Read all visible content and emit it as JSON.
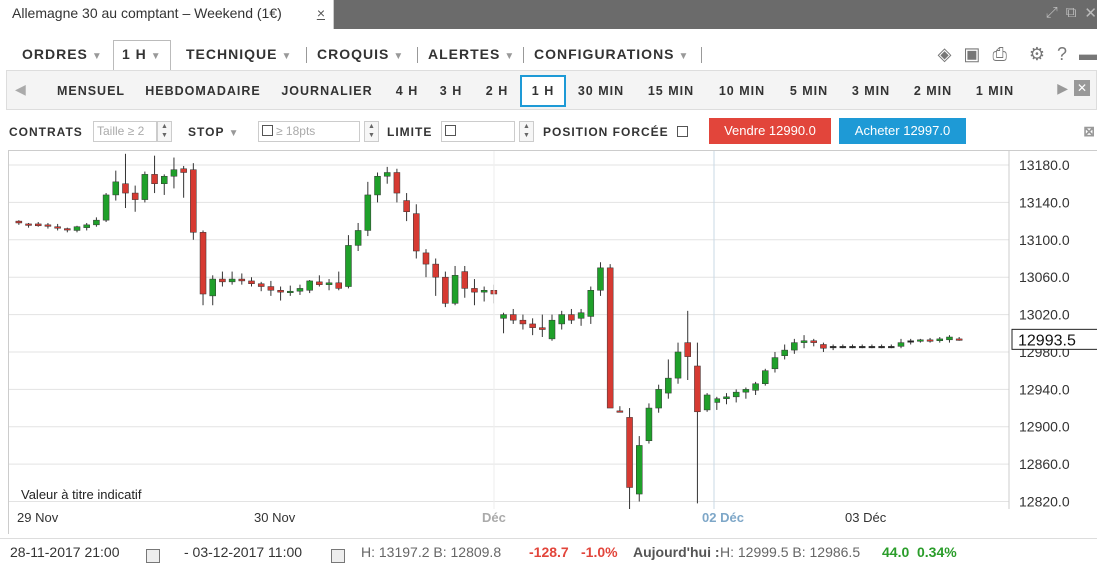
{
  "window": {
    "tab_title": "Allemagne 30 au comptant – Weekend (1€)",
    "tab_close": "×"
  },
  "menu": {
    "items": [
      {
        "label": "ORDRES"
      },
      {
        "label": "1 H"
      },
      {
        "label": "TECHNIQUE"
      },
      {
        "label": "CROQUIS"
      },
      {
        "label": "ALERTES"
      },
      {
        "label": "CONFIGURATIONS"
      }
    ]
  },
  "timeframes": {
    "items": [
      "MENSUEL",
      "HEBDOMADAIRE",
      "JOURNALIER",
      "4 H",
      "3 H",
      "2 H",
      "1 H",
      "30 MIN",
      "15 MIN",
      "10 MIN",
      "5 MIN",
      "3 MIN",
      "2 MIN",
      "1 MIN"
    ],
    "selected": "1 H"
  },
  "order": {
    "contrats_label": "CONTRATS",
    "taille_placeholder": "Taille ≥ 2",
    "stop_label": "STOP",
    "stop_placeholder": "≥ 18pts",
    "limite_label": "LIMITE",
    "position_label": "POSITION FORCÉE",
    "sell_label": "Vendre 12990.0",
    "buy_label": "Acheter 12997.0"
  },
  "chart_data": {
    "type": "candlestick",
    "y_ticks": [
      "13180.0",
      "13140.0",
      "13100.0",
      "13060.0",
      "13020.0",
      "12980.0",
      "12940.0",
      "12900.0",
      "12860.0",
      "12820.0"
    ],
    "ylim": [
      12812,
      13195
    ],
    "x_labels": [
      {
        "label": "29 Nov",
        "style": "normal"
      },
      {
        "label": "30 Nov",
        "style": "normal"
      },
      {
        "label": "Déc",
        "style": "muted"
      },
      {
        "label": "02 Déc",
        "style": "highlight"
      },
      {
        "label": "03 Déc",
        "style": "normal"
      }
    ],
    "current_price": "12993.5",
    "note": "Valeur à titre indicatif",
    "colors": {
      "up": "#1fa02a",
      "down": "#d63a32",
      "flat": "#222222",
      "highlight": "#1e9ad6"
    },
    "candles": [
      [
        13120,
        13121,
        13116,
        13118
      ],
      [
        13117,
        13118,
        13113,
        13116
      ],
      [
        13117,
        13119,
        13114,
        13115
      ],
      [
        13116,
        13118,
        13112,
        13115
      ],
      [
        13114,
        13117,
        13110,
        13113
      ],
      [
        13112,
        13113,
        13108,
        13111
      ],
      [
        13110,
        13115,
        13108,
        13114
      ],
      [
        13113,
        13118,
        13110,
        13116
      ],
      [
        13116,
        13124,
        13114,
        13121
      ],
      [
        13121,
        13150,
        13119,
        13148
      ],
      [
        13148,
        13174,
        13142,
        13162
      ],
      [
        13160,
        13192,
        13134,
        13150
      ],
      [
        13150,
        13158,
        13130,
        13143
      ],
      [
        13143,
        13173,
        13140,
        13170
      ],
      [
        13170,
        13190,
        13150,
        13160
      ],
      [
        13160,
        13170,
        13148,
        13168
      ],
      [
        13168,
        13188,
        13155,
        13175
      ],
      [
        13176,
        13179,
        13145,
        13172
      ],
      [
        13175,
        13182,
        13100,
        13108
      ],
      [
        13108,
        13110,
        13030,
        13042
      ],
      [
        13040,
        13062,
        13030,
        13058
      ],
      [
        13058,
        13066,
        13050,
        13055
      ],
      [
        13055,
        13066,
        13052,
        13058
      ],
      [
        13058,
        13064,
        13052,
        13056
      ],
      [
        13056,
        13060,
        13050,
        13053
      ],
      [
        13053,
        13055,
        13045,
        13050
      ],
      [
        13050,
        13056,
        13040,
        13046
      ],
      [
        13046,
        13050,
        13035,
        13044
      ],
      [
        13044,
        13051,
        13040,
        13045
      ],
      [
        13045,
        13052,
        13041,
        13048
      ],
      [
        13046,
        13057,
        13043,
        13056
      ],
      [
        13055,
        13062,
        13050,
        13052
      ],
      [
        13052,
        13058,
        13046,
        13054
      ],
      [
        13054,
        13066,
        13046,
        13048
      ],
      [
        13050,
        13105,
        13048,
        13094
      ],
      [
        13094,
        13118,
        13088,
        13110
      ],
      [
        13110,
        13162,
        13104,
        13148
      ],
      [
        13148,
        13172,
        13140,
        13168
      ],
      [
        13168,
        13178,
        13160,
        13172
      ],
      [
        13172,
        13176,
        13140,
        13150
      ],
      [
        13142,
        13150,
        13120,
        13130
      ],
      [
        13128,
        13138,
        13080,
        13088
      ],
      [
        13086,
        13090,
        13060,
        13074
      ],
      [
        13074,
        13080,
        13040,
        13060
      ],
      [
        13060,
        13066,
        13028,
        13032
      ],
      [
        13032,
        13072,
        13030,
        13062
      ],
      [
        13066,
        13072,
        13038,
        13048
      ],
      [
        13048,
        13058,
        13030,
        13044
      ],
      [
        13044,
        13050,
        13034,
        13046
      ],
      [
        13046,
        13052,
        13032,
        13042
      ],
      [
        13016,
        13022,
        13000,
        13020
      ],
      [
        13020,
        13026,
        13010,
        13014
      ],
      [
        13014,
        13020,
        13004,
        13010
      ],
      [
        13010,
        13016,
        12998,
        13006
      ],
      [
        13006,
        13020,
        12996,
        13004
      ],
      [
        12994,
        13020,
        12992,
        13014
      ],
      [
        13010,
        13024,
        13004,
        13020
      ],
      [
        13020,
        13026,
        13010,
        13014
      ],
      [
        13016,
        13026,
        13008,
        13022
      ],
      [
        13018,
        13050,
        13010,
        13046
      ],
      [
        13046,
        13076,
        13040,
        13070
      ],
      [
        13070,
        13074,
        12925,
        12920
      ],
      [
        12917,
        12922,
        12916,
        12916
      ],
      [
        12910,
        12920,
        12812,
        12835
      ],
      [
        12828,
        12890,
        12820,
        12880
      ],
      [
        12885,
        12925,
        12882,
        12920
      ],
      [
        12920,
        12945,
        12915,
        12940
      ],
      [
        12936,
        12972,
        12930,
        12952
      ],
      [
        12952,
        12990,
        12946,
        12980
      ],
      [
        12990,
        13024,
        12950,
        12975
      ],
      [
        12965,
        12990,
        12818,
        12916
      ],
      [
        12918,
        12936,
        12916,
        12934
      ],
      [
        12926,
        12932,
        12918,
        12930
      ],
      [
        12930,
        12936,
        12924,
        12932
      ],
      [
        12932,
        12940,
        12926,
        12937
      ],
      [
        12937,
        12942,
        12930,
        12940
      ],
      [
        12939,
        12948,
        12934,
        12946
      ],
      [
        12946,
        12962,
        12944,
        12960
      ],
      [
        12962,
        12980,
        12958,
        12974
      ],
      [
        12976,
        12988,
        12972,
        12982
      ],
      [
        12982,
        12994,
        12978,
        12990
      ],
      [
        12990,
        12998,
        12984,
        12992
      ],
      [
        12992,
        12994,
        12986,
        12990
      ],
      [
        12988,
        12990,
        12980,
        12984
      ],
      [
        12986,
        12988,
        12982,
        12986
      ],
      [
        12986,
        12988,
        12984,
        12986
      ],
      [
        12986,
        12988,
        12984,
        12986
      ],
      [
        12986,
        12988,
        12984,
        12986
      ],
      [
        12986,
        12988,
        12984,
        12986
      ],
      [
        12986,
        12988,
        12984,
        12986
      ],
      [
        12986,
        12988,
        12984,
        12986
      ],
      [
        12986,
        12994,
        12984,
        12990
      ],
      [
        12992,
        12994,
        12988,
        12992
      ],
      [
        12992,
        12994,
        12990,
        12993
      ],
      [
        12993,
        12995,
        12990,
        12992
      ],
      [
        12992,
        12996,
        12990,
        12994
      ],
      [
        12993,
        12998,
        12990,
        12996
      ],
      [
        12994,
        12996,
        12992,
        12993
      ]
    ]
  },
  "footer": {
    "date_from": "28-11-2017 21:00",
    "date_to": "- 03-12-2017 11:00",
    "hl": "H: 13197.2  B: 12809.8",
    "change": "-128.7",
    "change_pct": "-1.0%",
    "today_label": "Aujourd'hui :",
    "today_hl": "H: 12999.5  B: 12986.5",
    "today_change": "44.0",
    "today_pct": "0.34%"
  }
}
